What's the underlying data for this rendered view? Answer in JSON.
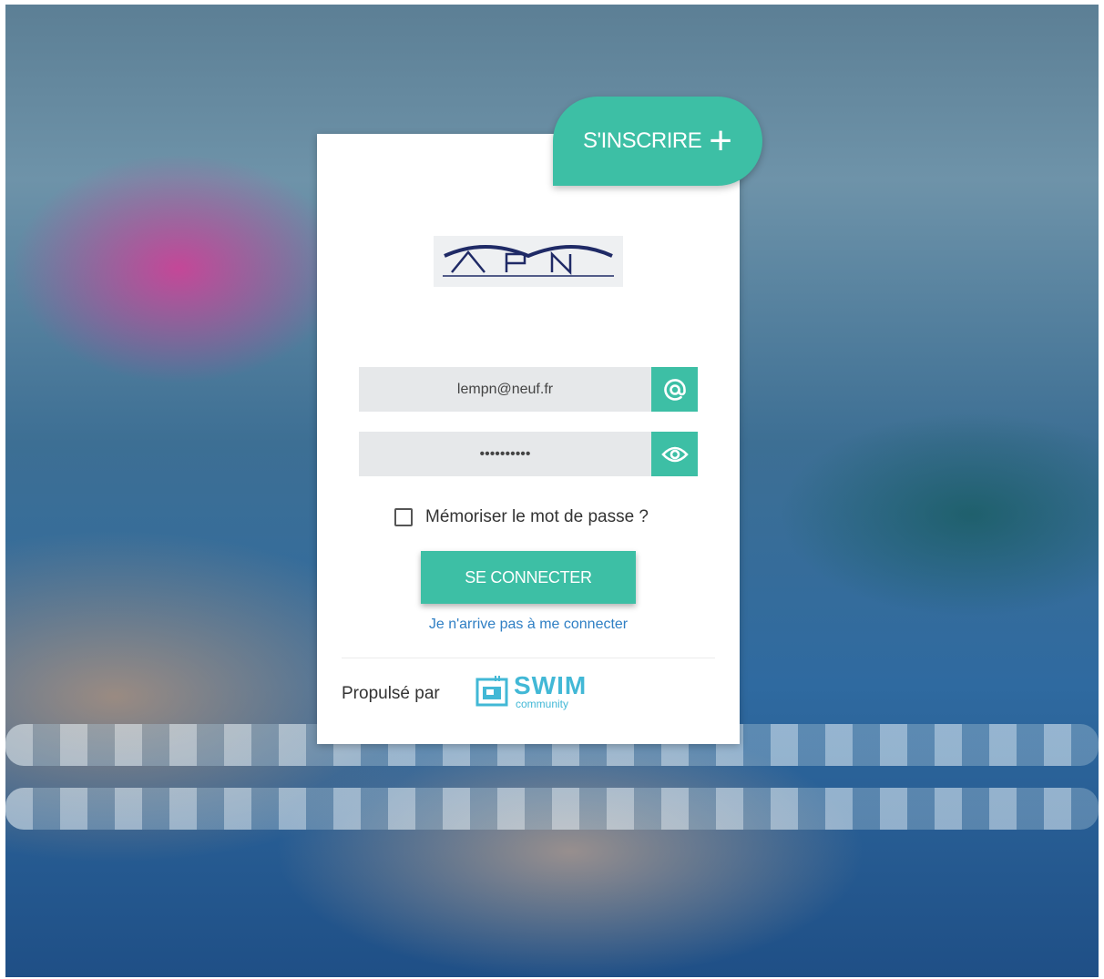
{
  "signup": {
    "label": "S'INSCRIRE",
    "icon": "plus-icon"
  },
  "logo": {
    "name": "MPN logo"
  },
  "email": {
    "value": "lempn@neuf.fr",
    "icon": "at-icon"
  },
  "password": {
    "value": "••••••••••",
    "icon": "eye-icon"
  },
  "remember": {
    "label": "Mémoriser le mot de passe ?",
    "checked": false
  },
  "login": {
    "label": "SE CONNECTER"
  },
  "forgot": {
    "label": "Je n'arrive pas à me connecter"
  },
  "footer": {
    "powered_by": "Propulsé par",
    "brand_name": "SWIM",
    "brand_sub": "community"
  },
  "colors": {
    "accent": "#3dbfa5",
    "link": "#2f7fc4",
    "brand": "#42b8d6"
  }
}
